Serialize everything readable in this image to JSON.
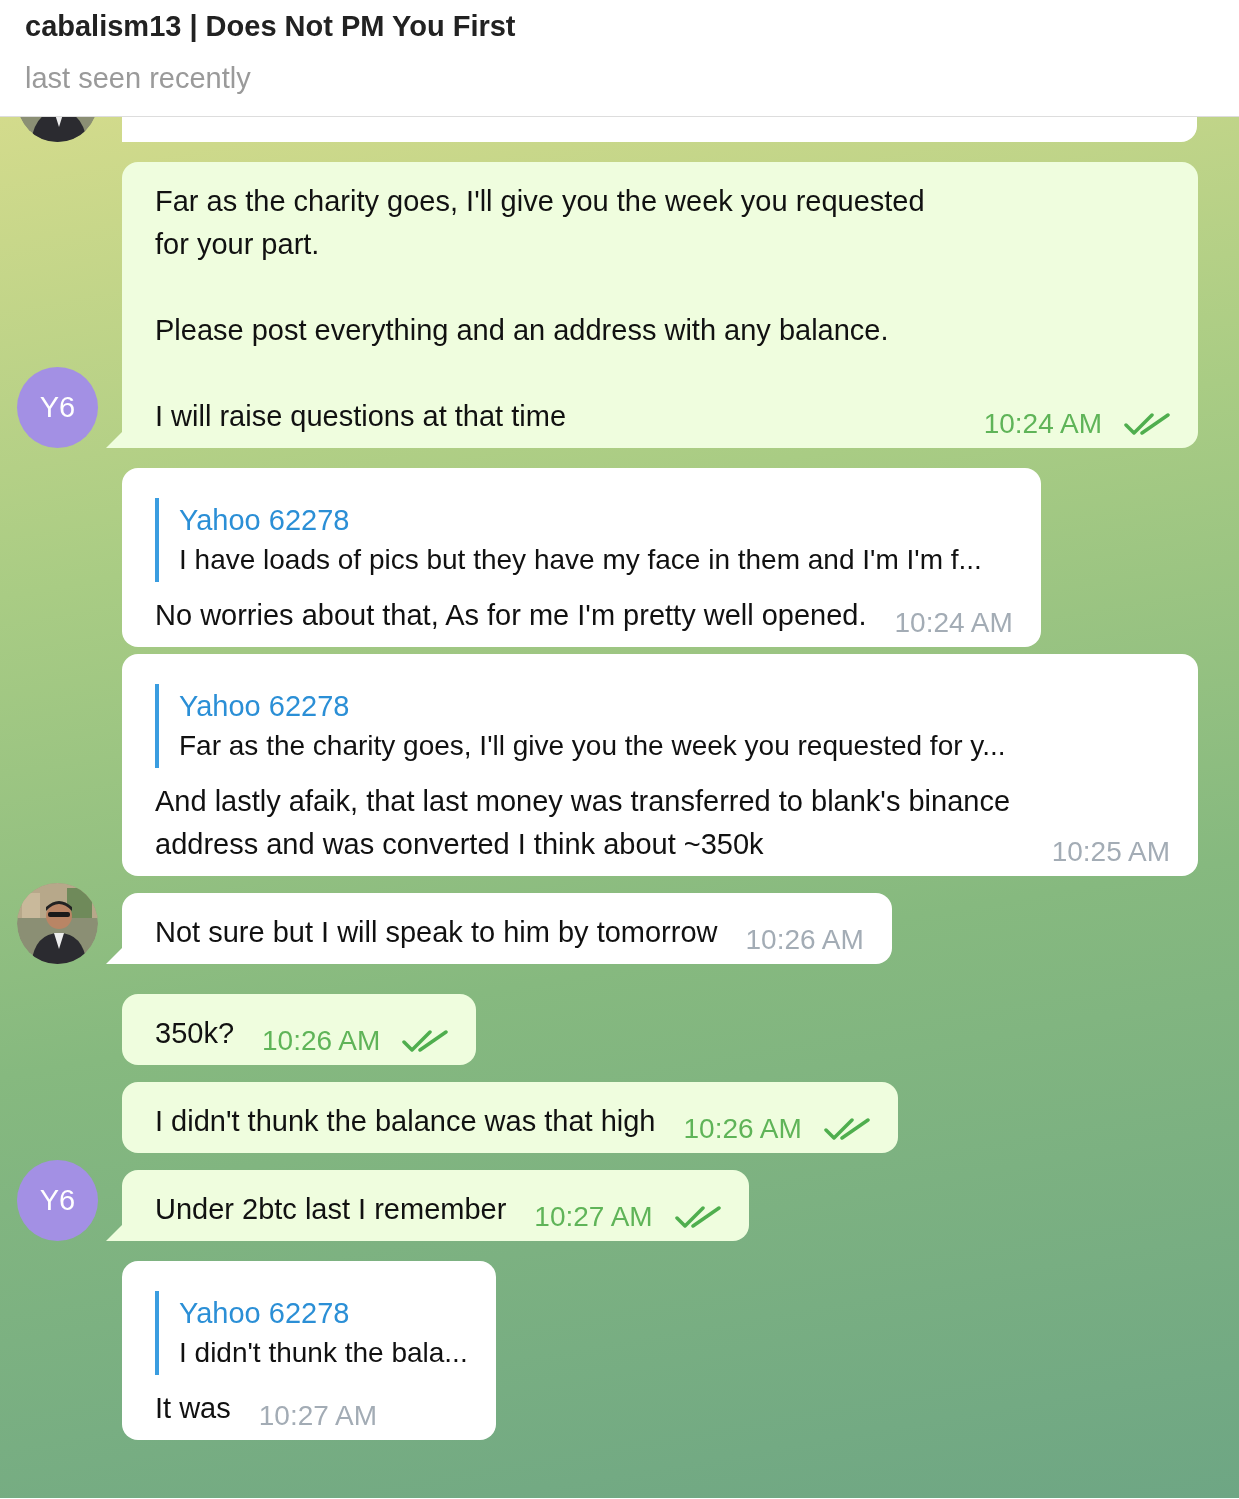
{
  "header": {
    "title": "cabalism13 | Does Not PM You First",
    "status": "last seen recently"
  },
  "cut_message": {
    "kind": "incoming"
  },
  "messages": [
    {
      "kind": "outgoing",
      "text": "Far as the charity goes, I'll give you the week you requested for your part.\n\nPlease post everything and an address with any balance.\n\nI will raise questions at that time",
      "time": "10:24 AM",
      "read": true,
      "avatar": {
        "kind": "initials",
        "text": "Y6"
      }
    },
    {
      "kind": "incoming",
      "reply": {
        "name": "Yahoo 62278",
        "text": "I have loads of pics but they have my face in them and I'm I'm f..."
      },
      "text": "No worries about that, As for me I'm pretty well opened.",
      "time": "10:24 AM"
    },
    {
      "kind": "incoming",
      "reply": {
        "name": "Yahoo 62278",
        "text": "Far as the charity goes, I'll give you the week you requested for y..."
      },
      "text": "And lastly afaik, that last money was transferred to blank's binance address and was converted I think about ~350k",
      "time": "10:25 AM"
    },
    {
      "kind": "incoming",
      "text": "Not sure but I will speak to him by tomorrow",
      "time": "10:26 AM"
    },
    {
      "kind": "outgoing",
      "text": "350k?",
      "time": "10:26 AM",
      "read": true
    },
    {
      "kind": "outgoing",
      "text": "I didn't thunk the balance was that high",
      "time": "10:26 AM",
      "read": true
    },
    {
      "kind": "outgoing",
      "text": "Under 2btc last I remember",
      "time": "10:27 AM",
      "read": true,
      "avatar": {
        "kind": "initials",
        "text": "Y6"
      }
    },
    {
      "kind": "incoming",
      "reply": {
        "name": "Yahoo 62278",
        "text": "I didn't thunk the bala..."
      },
      "text": "It was",
      "time": "10:27 AM"
    }
  ]
}
